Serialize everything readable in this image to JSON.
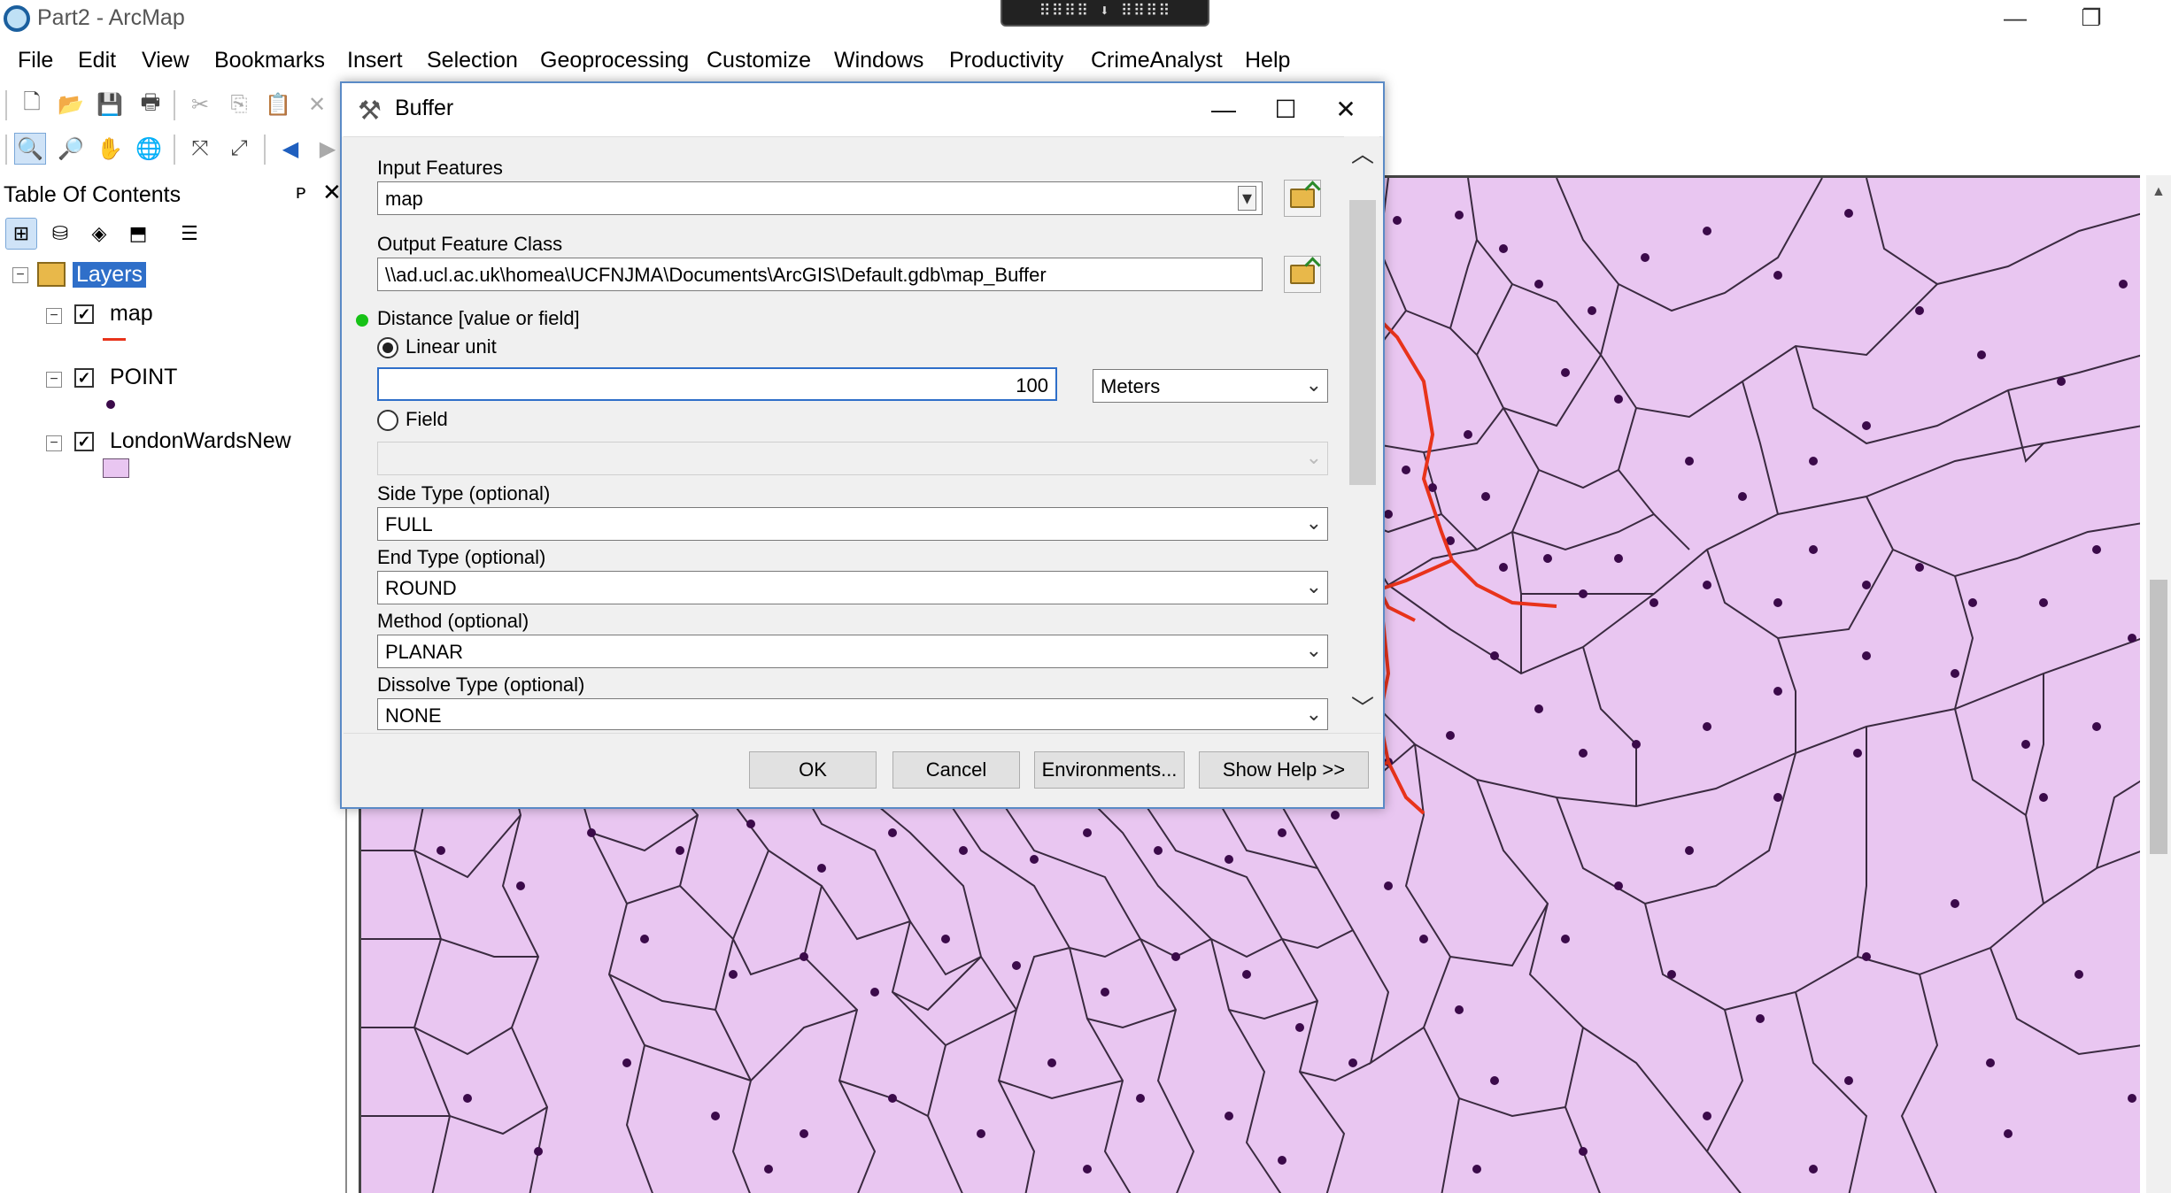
{
  "window": {
    "title": "Part2 - ArcMap",
    "minimize": "—",
    "restore": "❐"
  },
  "camera_bar": "⠿⠿⠿⠿ ⬇ ⠿⠿⠿⠿",
  "menu": [
    "File",
    "Edit",
    "View",
    "Bookmarks",
    "Insert",
    "Selection",
    "Geoprocessing",
    "Customize",
    "Windows",
    "Productivity",
    "CrimeAnalyst",
    "Help"
  ],
  "toolbar_icons": {
    "row1": [
      "new-document-icon",
      "open-icon",
      "save-icon",
      "print-icon",
      "cut-icon",
      "copy-icon",
      "paste-icon",
      "delete-icon"
    ],
    "row2": [
      "zoom-in-icon",
      "zoom-out-icon",
      "pan-icon",
      "full-extent-icon",
      "fixed-zoom-in-icon",
      "fixed-zoom-out-icon",
      "back-icon",
      "forward-icon"
    ]
  },
  "toc": {
    "title": "Table Of Contents",
    "pin": "ᴘ",
    "close": "✕",
    "root_label": "Layers",
    "layers": [
      {
        "name": "map",
        "checked": "✓",
        "symbol": "line",
        "color": "#e8331b"
      },
      {
        "name": "POINT",
        "checked": "✓",
        "symbol": "point",
        "color": "#3b0a4a"
      },
      {
        "name": "LondonWardsNew",
        "checked": "✓",
        "symbol": "polygon",
        "color": "#e9c6f1"
      }
    ]
  },
  "dialog": {
    "title": "Buffer",
    "input_features_label": "Input Features",
    "input_features_value": "map",
    "output_label": "Output Feature Class",
    "output_value": "\\\\ad.ucl.ac.uk\\homea\\UCFNJMA\\Documents\\ArcGIS\\Default.gdb\\map_Buffer",
    "distance_label": "Distance [value or field]",
    "linear_unit_label": "Linear unit",
    "distance_value": "100",
    "unit_value": "Meters",
    "field_label": "Field",
    "field_value": "",
    "side_type_label": "Side Type (optional)",
    "side_type_value": "FULL",
    "end_type_label": "End Type (optional)",
    "end_type_value": "ROUND",
    "method_label": "Method (optional)",
    "method_value": "PLANAR",
    "dissolve_label": "Dissolve Type (optional)",
    "dissolve_value": "NONE",
    "buttons": {
      "ok": "OK",
      "cancel": "Cancel",
      "environments": "Environments...",
      "help": "Show Help >>"
    }
  },
  "colors": {
    "ward_fill": "#e9c6f1",
    "ward_stroke": "#3a2a40",
    "route": "#e8331b",
    "points": "#3b0a4a",
    "dialog_border": "#5a8ac6"
  }
}
